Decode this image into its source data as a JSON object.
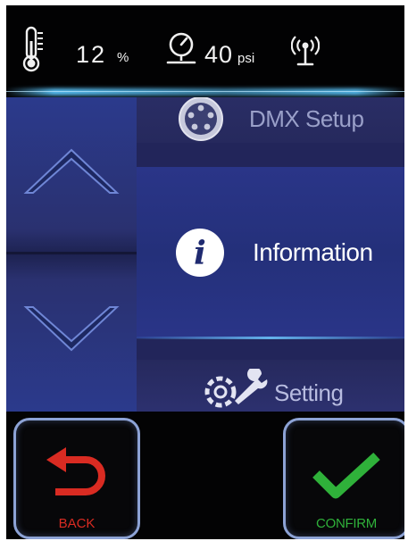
{
  "status": {
    "humidity_value": "12",
    "humidity_unit": "%",
    "pressure_value": "40",
    "pressure_unit": "psi",
    "icons": [
      "thermometer-icon",
      "pressure-gauge-icon",
      "wireless-antenna-icon"
    ]
  },
  "navigation": {
    "up_icon": "chevron-up-icon",
    "down_icon": "chevron-down-icon"
  },
  "menu": {
    "items": [
      {
        "label": "DMX Setup",
        "icon": "dmx-connector-icon"
      },
      {
        "label": "Information",
        "icon": "info-icon"
      },
      {
        "label": "Setting",
        "icon": "gear-wrench-icon"
      }
    ],
    "selected": "Information"
  },
  "buttons": {
    "back_label": "BACK",
    "confirm_label": "CONFIRM"
  },
  "colors": {
    "accent_glow": "#5ac8ff",
    "back": "#d92b22",
    "confirm": "#2fb13a",
    "panel": "#2a3588"
  }
}
